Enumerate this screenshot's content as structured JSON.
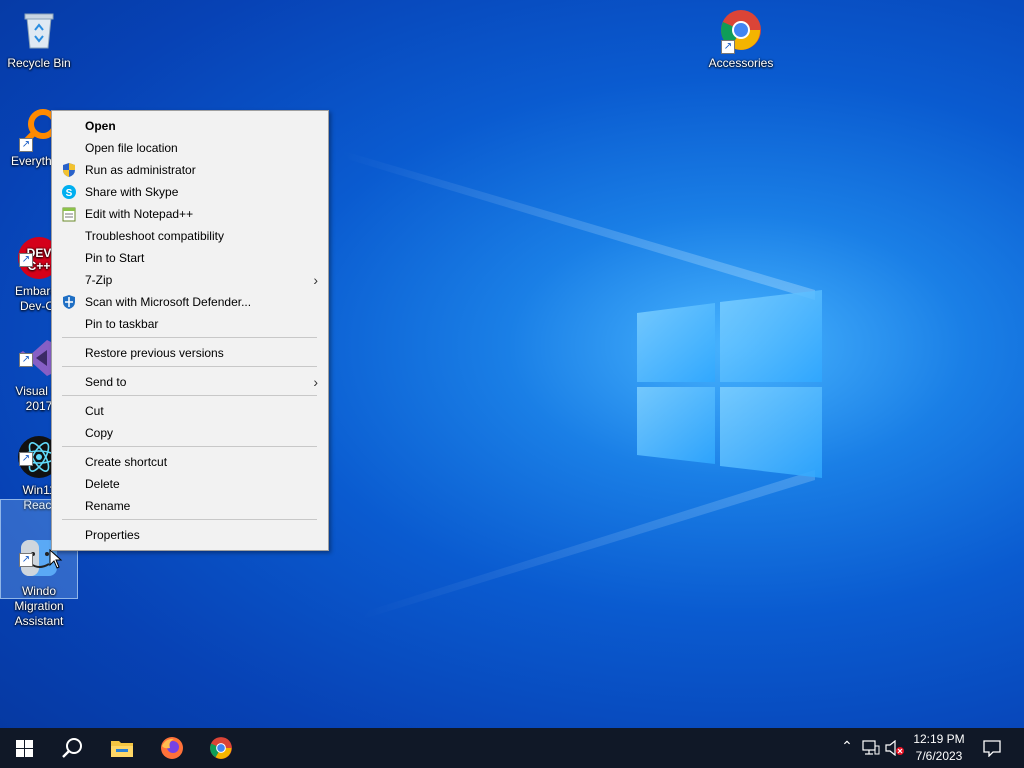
{
  "desktop": {
    "icons": [
      {
        "label": "Recycle Bin"
      },
      {
        "label": "Accessories"
      },
      {
        "label": "Everyth"
      },
      {
        "label": "Embarca\nDev-C-"
      },
      {
        "label": "Visual St\n2017"
      },
      {
        "label": "Win11\nReact"
      },
      {
        "label": "Windo\nMigration\nAssistant"
      }
    ]
  },
  "context_menu": {
    "items": [
      {
        "label": "Open",
        "bold": true
      },
      {
        "label": "Open file location"
      },
      {
        "label": "Run as administrator",
        "icon": "shield-icon"
      },
      {
        "label": "Share with Skype",
        "icon": "skype-icon"
      },
      {
        "label": "Edit with Notepad++",
        "icon": "notepadpp-icon"
      },
      {
        "label": "Troubleshoot compatibility"
      },
      {
        "label": "Pin to Start"
      },
      {
        "label": "7-Zip",
        "submenu": true
      },
      {
        "label": "Scan with Microsoft Defender...",
        "icon": "defender-icon"
      },
      {
        "label": "Pin to taskbar"
      },
      {
        "label": "Restore previous versions"
      },
      {
        "label": "Send to",
        "submenu": true
      },
      {
        "label": "Cut"
      },
      {
        "label": "Copy"
      },
      {
        "label": "Create shortcut"
      },
      {
        "label": "Delete"
      },
      {
        "label": "Rename"
      },
      {
        "label": "Properties"
      }
    ]
  },
  "taskbar": {
    "time": "12:19 PM",
    "date": "7/6/2023",
    "apps": [
      "start-icon",
      "search-icon",
      "file-explorer-icon",
      "firefox-icon",
      "chrome-icon"
    ]
  },
  "colors": {
    "menu_bg": "#f2f2f2",
    "taskbar_bg": "#101827",
    "desktop_blue": "#0a5bd0"
  }
}
